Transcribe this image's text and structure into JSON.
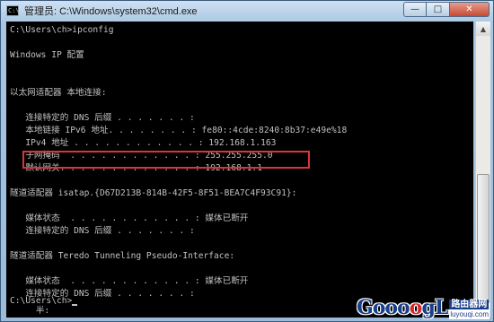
{
  "window": {
    "title": "管理员: C:\\Windows\\system32\\cmd.exe",
    "icon_label": "C:\\",
    "buttons": {
      "minimize": "—",
      "maximize": "□",
      "close": "✕"
    }
  },
  "console": {
    "lines": [
      "C:\\Users\\ch>ipconfig",
      "",
      "Windows IP 配置",
      "",
      "",
      "以太网适配器 本地连接:",
      "",
      "   连接特定的 DNS 后缀 . . . . . . . :",
      "   本地链接 IPv6 地址. . . . . . . . : fe80::4cde:8240:8b37:e49e%18",
      "   IPv4 地址 . . . . . . . . . . . . : 192.168.1.163",
      "   子网掩码  . . . . . . . . . . . . : 255.255.255.0",
      "   默认网关. . . . . . . . . . . . . : 192.168.1.1",
      "",
      "隧道适配器 isatap.{D67D213B-814B-42F5-8F51-BEA7C4F93C91}:",
      "",
      "   媒体状态  . . . . . . . . . . . . : 媒体已断开",
      "   连接特定的 DNS 后缀 . . . . . . . :",
      "",
      "隧道适配器 Teredo Tunneling Pseudo-Interface:",
      "",
      "   媒体状态  . . . . . . . . . . . . : 媒体已断开",
      "   连接特定的 DNS 后缀 . . . . . . . :",
      "",
      "C:\\Users\\ch>",
      "     半:"
    ]
  },
  "scrollbar": {
    "up_arrow": "▲",
    "down_arrow": "▼"
  },
  "watermark": {
    "logo_blue_1": "Gooo",
    "logo_red": "o",
    "logo_blue_2": "gL",
    "logo_dotcom": ".com",
    "site_cn": "路由器网",
    "site_url": "luyouqi.com"
  }
}
